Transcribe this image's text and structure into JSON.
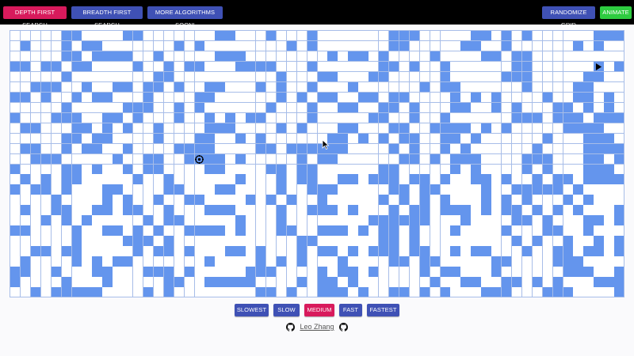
{
  "topbar": {
    "dfs_label": "DEPTH FIRST SEARCH",
    "bfs_label": "BREADTH FIRST SEARCH",
    "more_label": "MORE ALGORITHMS SOON!",
    "randomize_label": "RANDOMIZE GRID",
    "animate_label": "ANIMATE"
  },
  "speed": {
    "slowest_label": "SLOWEST",
    "slow_label": "SLOW",
    "medium_label": "MEDIUM",
    "fast_label": "FAST",
    "fastest_label": "FASTEST",
    "selected": "MEDIUM"
  },
  "footer": {
    "author": "Leo Zhang",
    "left_icon": "github-icon",
    "right_icon": "github-icon"
  },
  "colors": {
    "wall": "#6495ed",
    "empty": "#ffffff",
    "grid_line": "#a7bde8",
    "accent_pink": "#d81a5c",
    "accent_blue": "#3f51b5",
    "accent_green": "#2ecc40"
  },
  "grid": {
    "cols": 60,
    "rows": 26,
    "start_cell": [
      18,
      12
    ],
    "end_cell": [
      57,
      3
    ],
    "start_icon": "target-icon",
    "end_icon": "play-arrow-icon",
    "walls": [
      "0000011000011000000011000100010000000111000001101010000001111",
      "0100010110000000101000000001010000000110000011001000000101001",
      "0000011011110010000011100000000101101000010000110110000000001",
      "1101101100001001011000111100010000001101001000000110000001010",
      "0000010000000011000000000010001100011000001000001110000011000",
      "0011100100110110100110001010010001000000101100000010000110000",
      "1101001011000100001100000010101100110110000101010000100110100",
      "0000010000011100101000000100010011001101000110010100011010100",
      "1000111001101000100101011000010000011001001000000111011101111",
      "0110001101010010000111000010100011000110011110101000001111000",
      "0000011011000010001100101000000110101011001101000000100011100",
      "0110010110010000111100001101111110000101001010000001000011110",
      "0011100000100110011110100000101100000011010111000011100011010",
      "1000011010010110000110000110110000001100000101000010100011100",
      "0101011000001001000000100010110011011101101001101001011011111",
      "1011010001100001100011000010011100000110110000100111110100000",
      "0000100001010010011000010101001000001010101000101010001010000",
      "0100110011011001000111000010011101000101101110101101010100011",
      "0001010100000101100000100010000000011111100010000110100011011",
      "1100001001101010011110100011001110101101000100001000110010000",
      "0000001000011101000000000000110000001101000000000101001001010",
      "0011011000001011010001101000101101011101100101100010011011010",
      "0100001010110000000100001010100010000110110000011000011100000",
      "1100100011000111010000011100001011010000101100010000001110011",
      "1000010001000001100111110000101101000000010011001101010001110",
      "0010111110000101000000001101001110100110101000111000111000011"
    ]
  }
}
